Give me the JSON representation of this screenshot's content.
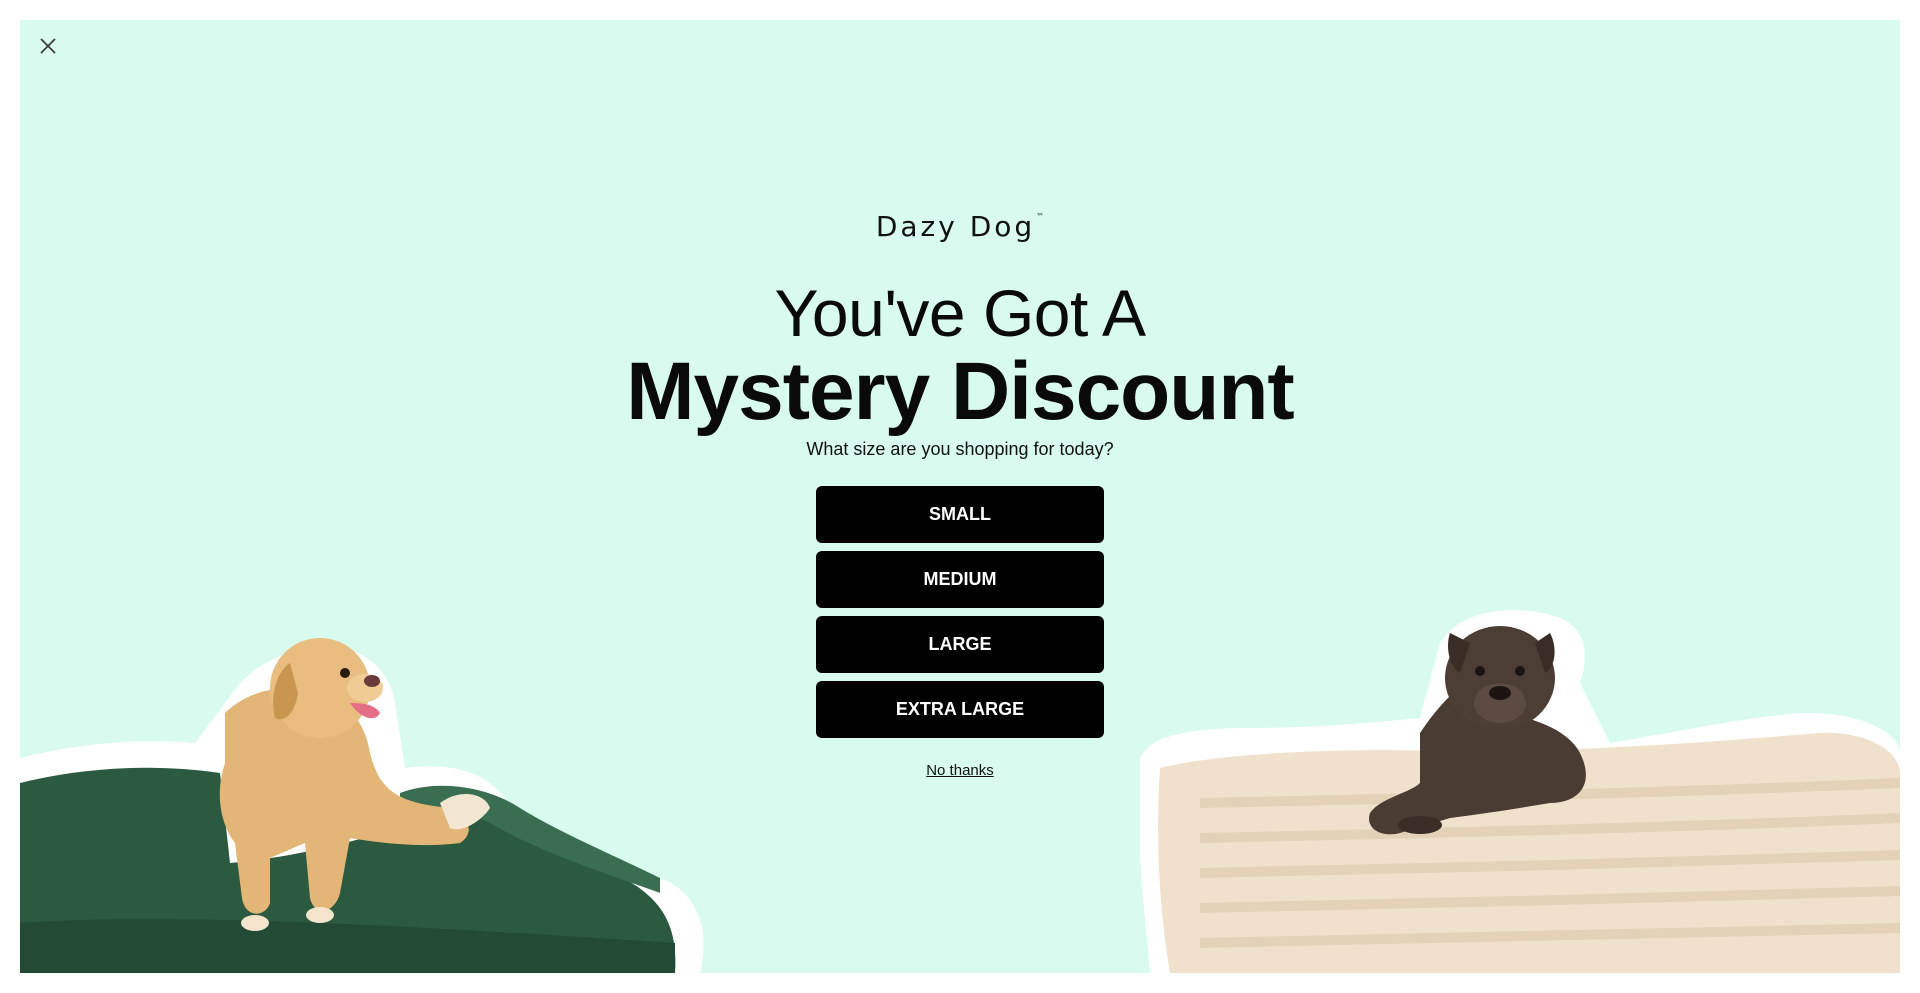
{
  "popup": {
    "close_icon": "close-icon",
    "logo": {
      "text": "Dazy Dog",
      "trademark": "™"
    },
    "headline_line1": "You've Got A",
    "headline_line2": "Mystery Discount",
    "question": "What size are you shopping for today?",
    "options": [
      {
        "label": "SMALL"
      },
      {
        "label": "MEDIUM"
      },
      {
        "label": "LARGE"
      },
      {
        "label": "EXTRA LARGE"
      }
    ],
    "dismiss_label": "No thanks"
  },
  "colors": {
    "background": "#d9fbef",
    "button": "#000000",
    "button_text": "#ffffff",
    "green_bed": "#2c5a40",
    "cream_bed": "#efe1cc"
  }
}
